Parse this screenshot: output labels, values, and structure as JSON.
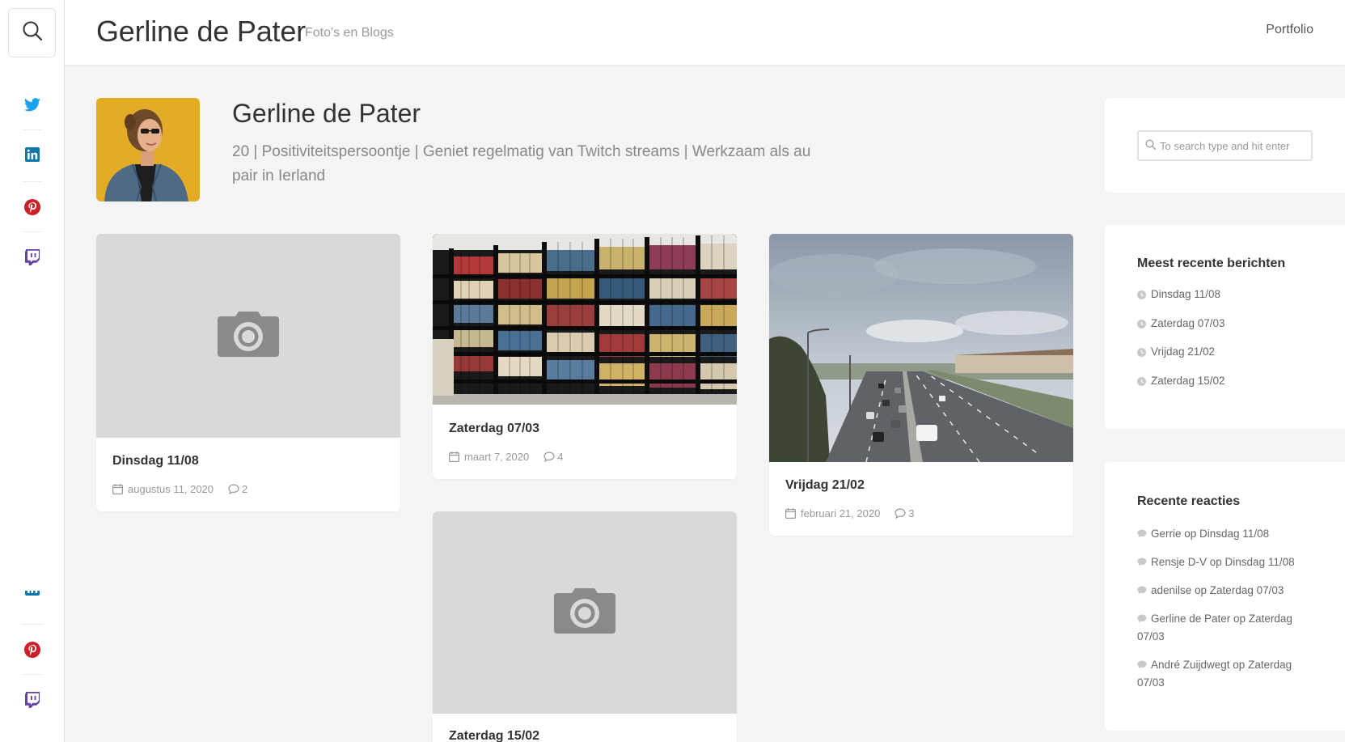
{
  "header": {
    "site_title": "Gerline de Pater",
    "tagline": "Foto's en Blogs",
    "nav_portfolio": "Portfolio"
  },
  "rail": {
    "icons": [
      "search-icon",
      "twitter-icon",
      "linkedin-icon",
      "pinterest-icon",
      "twitch-icon"
    ],
    "colors": {
      "twitter": "#1da1f2",
      "linkedin": "#0e76a8",
      "pinterest": "#cb2027",
      "twitch": "#6441a5"
    }
  },
  "profile": {
    "name": "Gerline de Pater",
    "bio": "20 | Positiviteitspersoontje | Geniet regelmatig van Twitch streams | Werkzaam als au pair in Ierland"
  },
  "posts": [
    {
      "title": "Dinsdag 11/08",
      "date": "augustus 11, 2020",
      "comments": "2",
      "image": "placeholder"
    },
    {
      "title": "Zaterdag 07/03",
      "date": "maart 7, 2020",
      "comments": "4",
      "image": "bookshelf"
    },
    {
      "title": "Vrijdag 21/02",
      "date": "februari 21, 2020",
      "comments": "3",
      "image": "motorway"
    },
    {
      "title": "Zaterdag 15/02",
      "image": "placeholder"
    }
  ],
  "sidebar": {
    "search_placeholder": "To search type and hit enter",
    "recent_posts_title": "Meest recente berichten",
    "recent_posts": [
      "Dinsdag 11/08",
      "Zaterdag 07/03",
      "Vrijdag 21/02",
      "Zaterdag 15/02"
    ],
    "recent_comments_title": "Recente reacties",
    "recent_comments": [
      "Gerrie op Dinsdag 11/08",
      "Rensje D-V op Dinsdag 11/08",
      "adenilse op Zaterdag 07/03",
      "Gerline de Pater op Zaterdag 07/03",
      "André Zuijdwegt op Zaterdag 07/03"
    ]
  }
}
